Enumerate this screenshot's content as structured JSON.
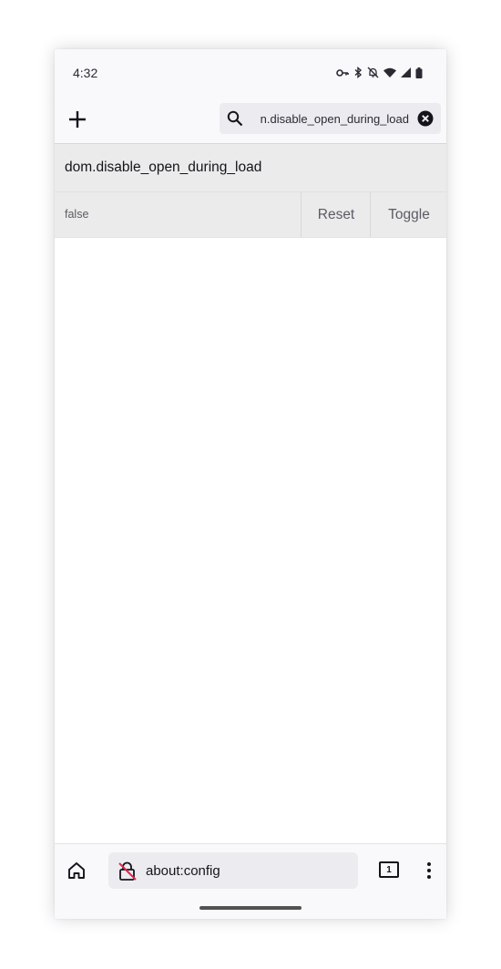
{
  "status_bar": {
    "time": "4:32",
    "icons": [
      "vpn-key-icon",
      "bluetooth-icon",
      "notifications-off-icon",
      "wifi-icon",
      "cellular-signal-icon",
      "battery-icon"
    ]
  },
  "toolbar": {
    "add_icon": "plus-icon",
    "search": {
      "icon": "search-icon",
      "value": "dom.disable_open_during_load",
      "visible_value": "n.disable_open_during_load",
      "clear_icon": "clear-icon"
    }
  },
  "pref": {
    "name": "dom.disable_open_during_load",
    "value": "false",
    "reset_label": "Reset",
    "toggle_label": "Toggle"
  },
  "bottom_bar": {
    "home_icon": "home-icon",
    "lock_icon": "insecure-lock-icon",
    "url": "about:config",
    "tab_count": "1",
    "menu_icon": "three-dot-menu-icon"
  },
  "colors": {
    "background": "#ffffff",
    "bars": "#f9f9fb",
    "row_bg": "#ebebeb",
    "text": "#15141a",
    "muted_text": "#5b5b66",
    "insecure_accent": "#e22850"
  }
}
